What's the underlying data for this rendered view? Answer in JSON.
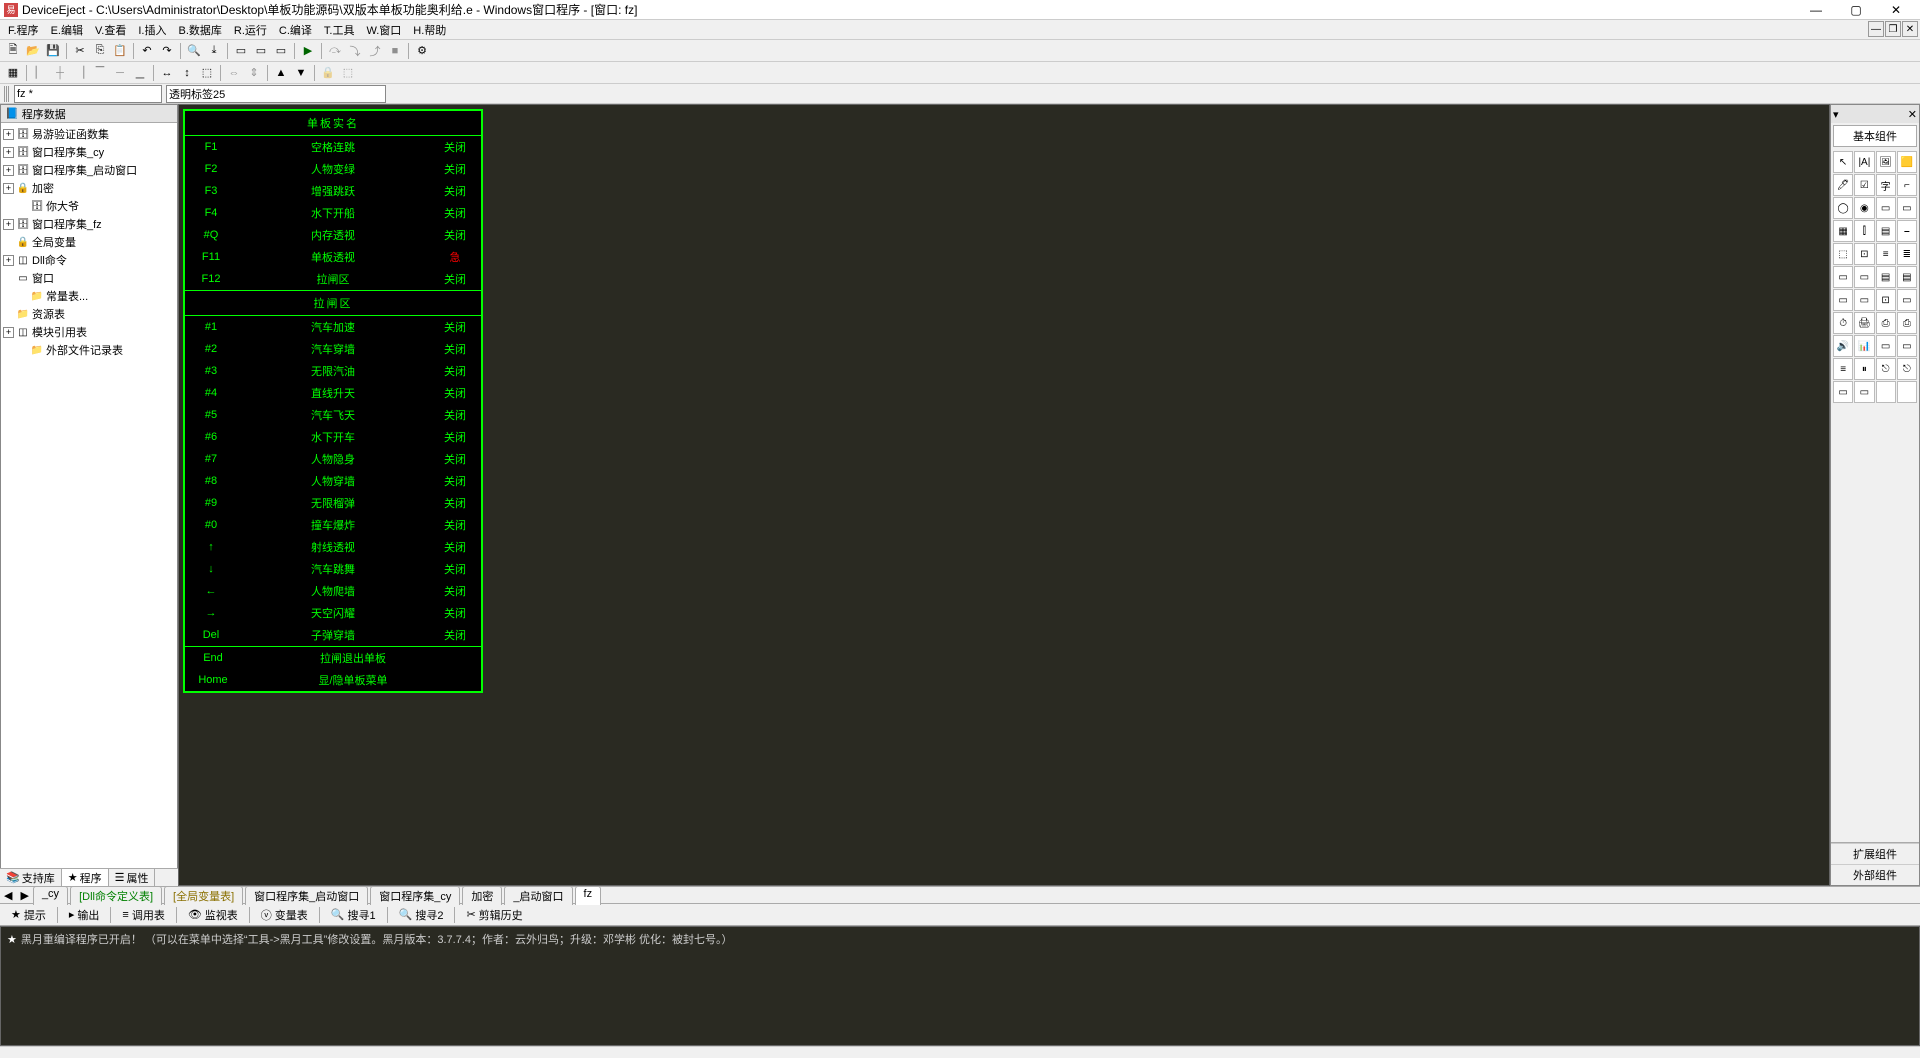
{
  "titlebar": {
    "title": "DeviceEject - C:\\Users\\Administrator\\Desktop\\单板功能源码\\双版本单板功能奥利给.e - Windows窗口程序 - [窗口: fz]"
  },
  "menu": [
    "F.程序",
    "E.编辑",
    "V.查看",
    "I.插入",
    "B.数据库",
    "R.运行",
    "C.编译",
    "T.工具",
    "W.窗口",
    "H.帮助"
  ],
  "combo": {
    "left": "fz *",
    "right": "透明标签25"
  },
  "tree": {
    "title": "程序数据",
    "items": [
      {
        "exp": "+",
        "icon": "ico-db",
        "label": "易游验证函数集"
      },
      {
        "exp": "+",
        "icon": "ico-db",
        "label": "窗口程序集_cy"
      },
      {
        "exp": "+",
        "icon": "ico-db",
        "label": "窗口程序集_启动窗口"
      },
      {
        "exp": "+",
        "icon": "ico-lock",
        "label": "加密"
      },
      {
        "exp": "",
        "icon": "ico-db",
        "label": "你大爷",
        "ind": 1
      },
      {
        "exp": "+",
        "icon": "ico-db",
        "label": "窗口程序集_fz"
      },
      {
        "exp": "",
        "icon": "ico-lock",
        "label": "全局变量",
        "ind": 0
      },
      {
        "exp": "+",
        "icon": "ico-mod",
        "label": "Dll命令"
      },
      {
        "exp": "",
        "icon": "ico-win",
        "label": "窗口",
        "ind": 0
      },
      {
        "exp": "",
        "icon": "ico-folder",
        "label": "常量表...",
        "ind": 1
      },
      {
        "exp": "",
        "icon": "ico-folder",
        "label": "资源表",
        "ind": 0
      },
      {
        "exp": "+",
        "icon": "ico-mod",
        "label": "模块引用表"
      },
      {
        "exp": "",
        "icon": "ico-folder",
        "label": "外部文件记录表",
        "ind": 1
      }
    ]
  },
  "left_tabs": [
    "支持库",
    "程序",
    "属性"
  ],
  "designer": {
    "title": "单板实名",
    "rows1": [
      {
        "k": "F1",
        "n": "空格连跳",
        "s": "关闭"
      },
      {
        "k": "F2",
        "n": "人物变绿",
        "s": "关闭"
      },
      {
        "k": "F3",
        "n": "增强跳跃",
        "s": "关闭"
      },
      {
        "k": "F4",
        "n": "水下开船",
        "s": "关闭"
      },
      {
        "k": "#Q",
        "n": "内存透视",
        "s": "关闭"
      },
      {
        "k": "F11",
        "n": "单板透视",
        "s": "急",
        "red": true
      },
      {
        "k": "F12",
        "n": "拉闸区",
        "s": "关闭"
      }
    ],
    "mid_title": "拉闸区",
    "rows2": [
      {
        "k": "#1",
        "n": "汽车加速",
        "s": "关闭"
      },
      {
        "k": "#2",
        "n": "汽车穿墙",
        "s": "关闭"
      },
      {
        "k": "#3",
        "n": "无限汽油",
        "s": "关闭"
      },
      {
        "k": "#4",
        "n": "直线升天",
        "s": "关闭"
      },
      {
        "k": "#5",
        "n": "汽车飞天",
        "s": "关闭"
      },
      {
        "k": "#6",
        "n": "水下开车",
        "s": "关闭"
      },
      {
        "k": "#7",
        "n": "人物隐身",
        "s": "关闭"
      },
      {
        "k": "#8",
        "n": "人物穿墙",
        "s": "关闭"
      },
      {
        "k": "#9",
        "n": "无限榴弹",
        "s": "关闭"
      },
      {
        "k": "#0",
        "n": "撞车爆炸",
        "s": "关闭"
      },
      {
        "k": "↑",
        "n": "射线透视",
        "s": "关闭"
      },
      {
        "k": "↓",
        "n": "汽车跳舞",
        "s": "关闭"
      },
      {
        "k": "←",
        "n": "人物爬墙",
        "s": "关闭"
      },
      {
        "k": "→",
        "n": "天空闪耀",
        "s": "关闭"
      },
      {
        "k": "Del",
        "n": "子弹穿墙",
        "s": "关闭"
      }
    ],
    "rows3": [
      {
        "k": "End",
        "n": "拉闸退出单板"
      },
      {
        "k": "Home",
        "n": "显/隐单板菜单"
      }
    ]
  },
  "right": {
    "title": "基本组件",
    "foot": [
      "扩展组件",
      "外部组件"
    ],
    "cells": [
      "↖",
      "|A|",
      "🖼",
      "🟨",
      "🖊",
      "☑",
      "字",
      "⌐",
      "◯",
      "◉",
      "▭",
      "▭",
      "▦",
      "⫿",
      "▤",
      "⎯",
      "⬚",
      "⊡",
      "≡",
      "≣",
      "▭",
      "▭",
      "▤",
      "▤",
      "▭",
      "▭",
      "⊡",
      "▭",
      "⏱",
      "🖨",
      "⎙",
      "⎙",
      "🔊",
      "📊",
      "▭",
      "▭",
      "≡",
      "⏸",
      "⎋",
      "⎋",
      "▭",
      "▭",
      "",
      ""
    ]
  },
  "doctabs": [
    {
      "label": "_cy",
      "cls": ""
    },
    {
      "label": "[Dll命令定义表]",
      "cls": "green"
    },
    {
      "label": "[全局变量表]",
      "cls": "gold"
    },
    {
      "label": "窗口程序集_启动窗口",
      "cls": ""
    },
    {
      "label": "窗口程序集_cy",
      "cls": ""
    },
    {
      "label": "加密",
      "cls": ""
    },
    {
      "label": "_启动窗口",
      "cls": ""
    },
    {
      "label": "fz",
      "cls": "active"
    }
  ],
  "outtabs": [
    "提示",
    "输出",
    "调用表",
    "监视表",
    "变量表",
    "搜寻1",
    "搜寻2",
    "剪辑历史"
  ],
  "console": {
    "line": "黑月重编译程序已开启！ （可以在菜单中选择“工具->黑月工具”修改设置。黑月版本：3.7.7.4；作者：云外归鸟；升级：邓学彬 优化：被封七号。）"
  }
}
